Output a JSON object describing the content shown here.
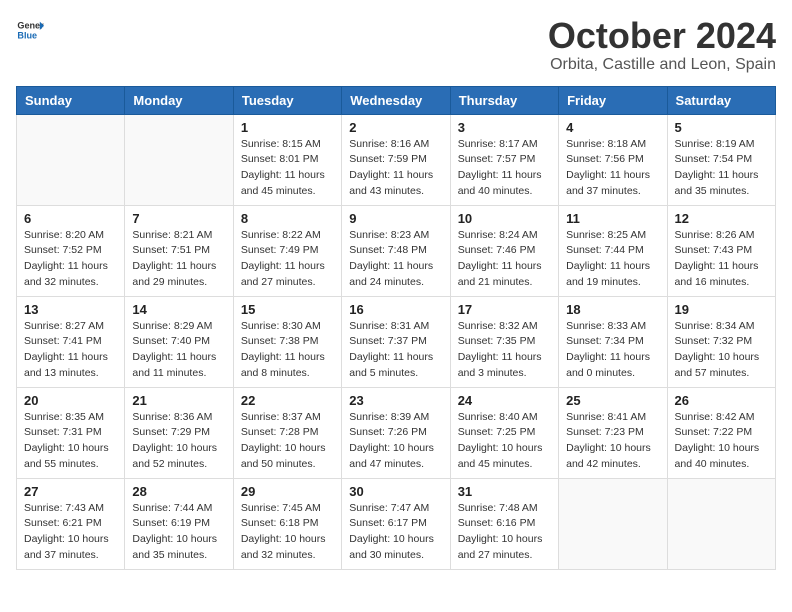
{
  "header": {
    "logo_general": "General",
    "logo_blue": "Blue",
    "month": "October 2024",
    "location": "Orbita, Castille and Leon, Spain"
  },
  "weekdays": [
    "Sunday",
    "Monday",
    "Tuesday",
    "Wednesday",
    "Thursday",
    "Friday",
    "Saturday"
  ],
  "weeks": [
    [
      {
        "day": "",
        "info": ""
      },
      {
        "day": "",
        "info": ""
      },
      {
        "day": "1",
        "info": "Sunrise: 8:15 AM\nSunset: 8:01 PM\nDaylight: 11 hours and 45 minutes."
      },
      {
        "day": "2",
        "info": "Sunrise: 8:16 AM\nSunset: 7:59 PM\nDaylight: 11 hours and 43 minutes."
      },
      {
        "day": "3",
        "info": "Sunrise: 8:17 AM\nSunset: 7:57 PM\nDaylight: 11 hours and 40 minutes."
      },
      {
        "day": "4",
        "info": "Sunrise: 8:18 AM\nSunset: 7:56 PM\nDaylight: 11 hours and 37 minutes."
      },
      {
        "day": "5",
        "info": "Sunrise: 8:19 AM\nSunset: 7:54 PM\nDaylight: 11 hours and 35 minutes."
      }
    ],
    [
      {
        "day": "6",
        "info": "Sunrise: 8:20 AM\nSunset: 7:52 PM\nDaylight: 11 hours and 32 minutes."
      },
      {
        "day": "7",
        "info": "Sunrise: 8:21 AM\nSunset: 7:51 PM\nDaylight: 11 hours and 29 minutes."
      },
      {
        "day": "8",
        "info": "Sunrise: 8:22 AM\nSunset: 7:49 PM\nDaylight: 11 hours and 27 minutes."
      },
      {
        "day": "9",
        "info": "Sunrise: 8:23 AM\nSunset: 7:48 PM\nDaylight: 11 hours and 24 minutes."
      },
      {
        "day": "10",
        "info": "Sunrise: 8:24 AM\nSunset: 7:46 PM\nDaylight: 11 hours and 21 minutes."
      },
      {
        "day": "11",
        "info": "Sunrise: 8:25 AM\nSunset: 7:44 PM\nDaylight: 11 hours and 19 minutes."
      },
      {
        "day": "12",
        "info": "Sunrise: 8:26 AM\nSunset: 7:43 PM\nDaylight: 11 hours and 16 minutes."
      }
    ],
    [
      {
        "day": "13",
        "info": "Sunrise: 8:27 AM\nSunset: 7:41 PM\nDaylight: 11 hours and 13 minutes."
      },
      {
        "day": "14",
        "info": "Sunrise: 8:29 AM\nSunset: 7:40 PM\nDaylight: 11 hours and 11 minutes."
      },
      {
        "day": "15",
        "info": "Sunrise: 8:30 AM\nSunset: 7:38 PM\nDaylight: 11 hours and 8 minutes."
      },
      {
        "day": "16",
        "info": "Sunrise: 8:31 AM\nSunset: 7:37 PM\nDaylight: 11 hours and 5 minutes."
      },
      {
        "day": "17",
        "info": "Sunrise: 8:32 AM\nSunset: 7:35 PM\nDaylight: 11 hours and 3 minutes."
      },
      {
        "day": "18",
        "info": "Sunrise: 8:33 AM\nSunset: 7:34 PM\nDaylight: 11 hours and 0 minutes."
      },
      {
        "day": "19",
        "info": "Sunrise: 8:34 AM\nSunset: 7:32 PM\nDaylight: 10 hours and 57 minutes."
      }
    ],
    [
      {
        "day": "20",
        "info": "Sunrise: 8:35 AM\nSunset: 7:31 PM\nDaylight: 10 hours and 55 minutes."
      },
      {
        "day": "21",
        "info": "Sunrise: 8:36 AM\nSunset: 7:29 PM\nDaylight: 10 hours and 52 minutes."
      },
      {
        "day": "22",
        "info": "Sunrise: 8:37 AM\nSunset: 7:28 PM\nDaylight: 10 hours and 50 minutes."
      },
      {
        "day": "23",
        "info": "Sunrise: 8:39 AM\nSunset: 7:26 PM\nDaylight: 10 hours and 47 minutes."
      },
      {
        "day": "24",
        "info": "Sunrise: 8:40 AM\nSunset: 7:25 PM\nDaylight: 10 hours and 45 minutes."
      },
      {
        "day": "25",
        "info": "Sunrise: 8:41 AM\nSunset: 7:23 PM\nDaylight: 10 hours and 42 minutes."
      },
      {
        "day": "26",
        "info": "Sunrise: 8:42 AM\nSunset: 7:22 PM\nDaylight: 10 hours and 40 minutes."
      }
    ],
    [
      {
        "day": "27",
        "info": "Sunrise: 7:43 AM\nSunset: 6:21 PM\nDaylight: 10 hours and 37 minutes."
      },
      {
        "day": "28",
        "info": "Sunrise: 7:44 AM\nSunset: 6:19 PM\nDaylight: 10 hours and 35 minutes."
      },
      {
        "day": "29",
        "info": "Sunrise: 7:45 AM\nSunset: 6:18 PM\nDaylight: 10 hours and 32 minutes."
      },
      {
        "day": "30",
        "info": "Sunrise: 7:47 AM\nSunset: 6:17 PM\nDaylight: 10 hours and 30 minutes."
      },
      {
        "day": "31",
        "info": "Sunrise: 7:48 AM\nSunset: 6:16 PM\nDaylight: 10 hours and 27 minutes."
      },
      {
        "day": "",
        "info": ""
      },
      {
        "day": "",
        "info": ""
      }
    ]
  ]
}
